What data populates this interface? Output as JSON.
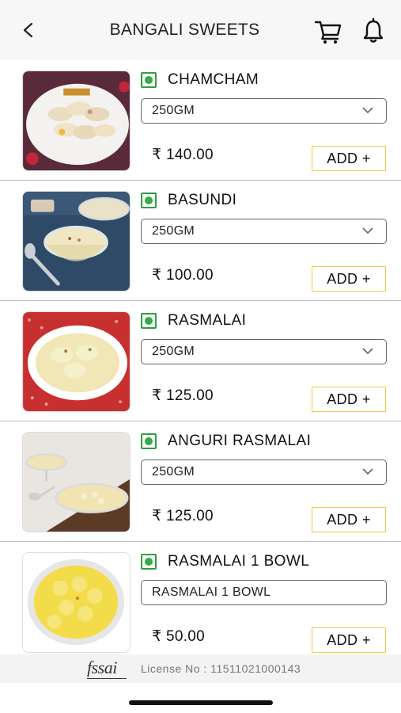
{
  "header": {
    "title": "BANGALI SWEETS",
    "back_icon": "chevron-left-icon",
    "cart_icon": "cart-icon",
    "bell_icon": "bell-icon"
  },
  "items": [
    {
      "name": "CHAMCHAM",
      "option": "250GM",
      "price": "₹ 140.00",
      "add_label": "ADD +",
      "has_dropdown": true,
      "veg": true
    },
    {
      "name": "BASUNDI",
      "option": "250GM",
      "price": "₹ 100.00",
      "add_label": "ADD +",
      "has_dropdown": true,
      "veg": true
    },
    {
      "name": "RASMALAI",
      "option": "250GM",
      "price": "₹ 125.00",
      "add_label": "ADD +",
      "has_dropdown": true,
      "veg": true
    },
    {
      "name": "ANGURI RASMALAI",
      "option": "250GM",
      "price": "₹ 125.00",
      "add_label": "ADD +",
      "has_dropdown": true,
      "veg": true
    },
    {
      "name": "RASMALAI 1 BOWL",
      "option": "RASMALAI 1 BOWL",
      "price": "₹ 50.00",
      "add_label": "ADD +",
      "has_dropdown": false,
      "veg": true
    }
  ],
  "footer": {
    "fssai_logo": "fssai",
    "license": "License No : 11511021000143"
  },
  "colors": {
    "veg_green": "#2fae45",
    "add_border": "#f2c84b",
    "header_bg": "#f7f7f7"
  }
}
